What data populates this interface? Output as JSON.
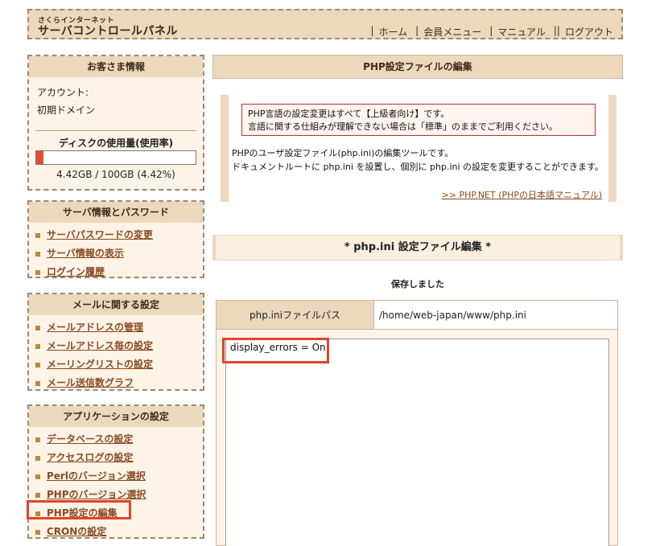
{
  "header": {
    "brand_small": "さくらインターネット",
    "brand_main": "サーバコントロールパネル",
    "nav": [
      {
        "sep": "|",
        "label": "ホーム"
      },
      {
        "sep": "|",
        "label": "会員メニュー"
      },
      {
        "sep": "|",
        "label": "マニュアル"
      },
      {
        "sep": "||",
        "label": "ログアウト"
      }
    ]
  },
  "sidebar": {
    "customer": {
      "title": "お客さま情報",
      "account_label": "アカウント:",
      "domain_label": "初期ドメイン",
      "disk_title": "ディスクの使用量(使用率)",
      "disk_text": "4.42GB / 100GB (4.42%)",
      "disk_usage_fraction": 0.0442
    },
    "server": {
      "title": "サーバ情報とパスワード",
      "items": [
        "サーバパスワードの変更",
        "サーバ情報の表示",
        "ログイン履歴"
      ]
    },
    "mail": {
      "title": "メールに関する設定",
      "items": [
        "メールアドレスの管理",
        "メールアドレス毎の設定",
        "メーリングリストの設定",
        "メール送信数グラフ"
      ]
    },
    "apps": {
      "title": "アプリケーションの設定",
      "items": [
        "データベースの設定",
        "アクセスログの設定",
        "Perlのバージョン選択",
        "PHPのバージョン選択",
        "PHP設定の編集",
        "CRONの設定"
      ]
    }
  },
  "main": {
    "title": "PHP設定ファイルの編集",
    "warning_line1": "PHP言語の設定変更はすべて【上級者向け】です。",
    "warning_line2": "言語に関する仕組みが理解できない場合は「標準」のままでご利用ください。",
    "desc_line1": "PHPのユーザ設定ファイル(php.ini)の編集ツールです。",
    "desc_line2": "ドキュメントルートに php.ini を設置し、個別に php.ini の設定を変更することができます。",
    "manual_link": ">> PHP.NET (PHPの日本語マニュアル)",
    "section_title": "* php.ini 設定ファイル編集 *",
    "saved_msg": "保存しました",
    "path_label": "php.iniファイルパス",
    "path_value": "/home/web-japan/www/php.ini",
    "editor_content": "display_errors = On"
  },
  "colors": {
    "header_bg": "#ecd9bd",
    "panel_bg": "#fdf3e7",
    "link": "#8a4a20",
    "highlight": "#e0442c",
    "disk_fill": "#e05030"
  }
}
